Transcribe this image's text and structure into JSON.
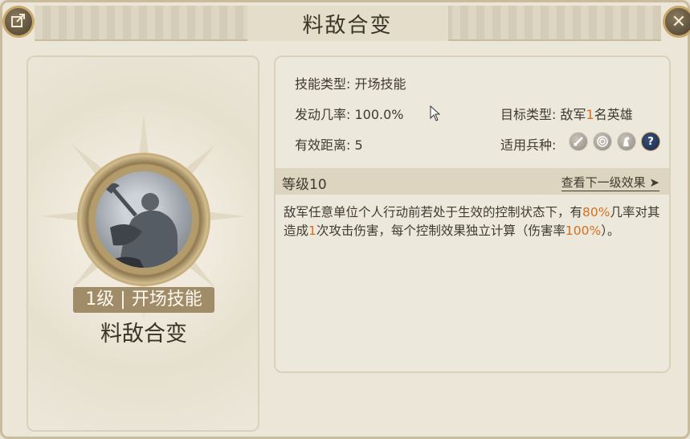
{
  "title": "料敌合变",
  "icons": {
    "share": "share-icon",
    "close": "close-icon",
    "units": [
      "sword-icon",
      "bow-target-icon",
      "horse-icon",
      "question-icon"
    ]
  },
  "colors": {
    "highlight": "#d2701f"
  },
  "skill": {
    "level_tag": "1级 | 开场技能",
    "name": "料敌合变"
  },
  "info": {
    "type_label": "技能类型:",
    "type_value": "开场技能",
    "rate_label": "发动几率:",
    "rate_value": "100.0%",
    "target_label": "目标类型:",
    "target_pre": "敌军",
    "target_num": "1",
    "target_post": "名英雄",
    "range_label": "有效距离:",
    "range_value": "5",
    "units_label": "适用兵种:",
    "unit_q": "?"
  },
  "level": {
    "label": "等级10",
    "next": "查看下一级效果 ➤"
  },
  "description": {
    "p1": "敌军任意单位个人行动前若处于生效的控制状态下，有",
    "h1": "80%",
    "p2": "几率对其造成",
    "h2": "1",
    "p3": "次攻击伤害，每个控制效果独立计算（伤害率",
    "h3": "100%",
    "p4": "）。"
  }
}
